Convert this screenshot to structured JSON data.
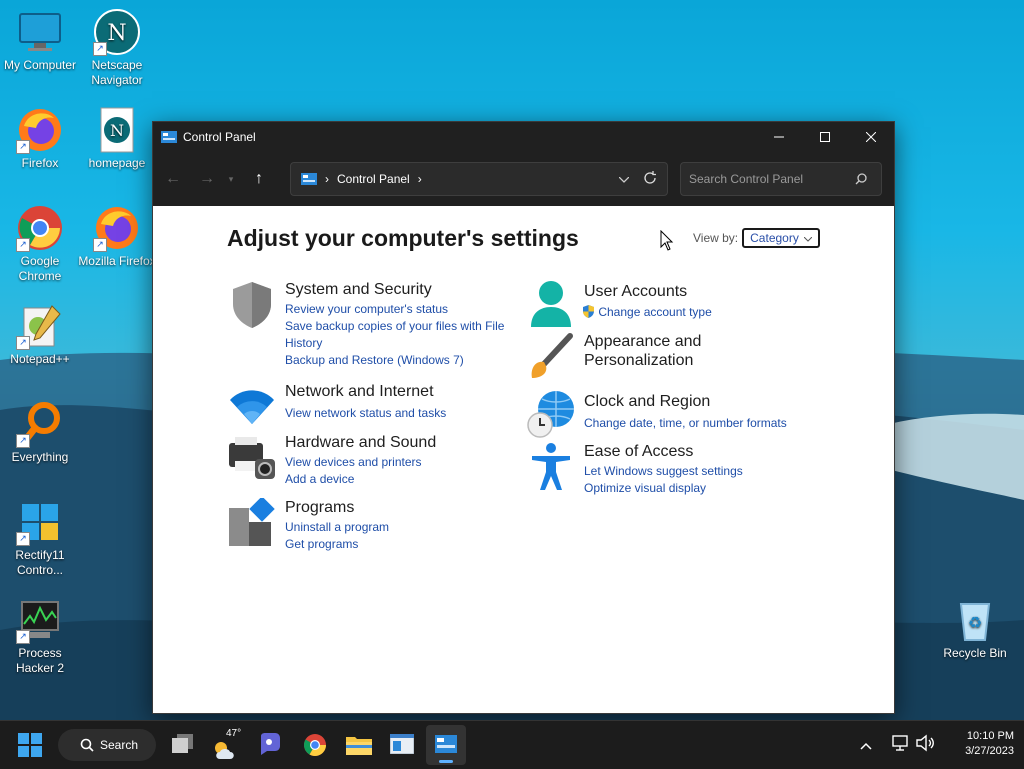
{
  "desktop": {
    "icons": [
      {
        "label": "My Computer"
      },
      {
        "label": "Netscape Navigator"
      },
      {
        "label": "Firefox"
      },
      {
        "label": "homepage"
      },
      {
        "label": "Google Chrome"
      },
      {
        "label": "Mozilla Firefox"
      },
      {
        "label": "Notepad++"
      },
      {
        "label": "Everything"
      },
      {
        "label": "Rectify11 Contro..."
      },
      {
        "label": "Process Hacker 2"
      },
      {
        "label": "Recycle Bin"
      }
    ]
  },
  "window": {
    "title": "Control Panel",
    "address": {
      "segment": "Control Panel",
      "sep": "›"
    },
    "search_placeholder": "Search Control Panel",
    "heading": "Adjust your computer's settings",
    "view_by_label": "View by:",
    "view_by_value": "Category",
    "categories": [
      {
        "title": "System and Security",
        "links": [
          "Review your computer's status",
          "Save backup copies of your files with File History",
          "Backup and Restore (Windows 7)"
        ]
      },
      {
        "title": "Network and Internet",
        "links": [
          "View network status and tasks"
        ]
      },
      {
        "title": "Hardware and Sound",
        "links": [
          "View devices and printers",
          "Add a device"
        ]
      },
      {
        "title": "Programs",
        "links": [
          "Uninstall a program",
          "Get programs"
        ]
      },
      {
        "title": "User Accounts",
        "links": [
          "Change account type"
        ]
      },
      {
        "title": "Appearance and Personalization",
        "links": []
      },
      {
        "title": "Clock and Region",
        "links": [
          "Change date, time, or number formats"
        ]
      },
      {
        "title": "Ease of Access",
        "links": [
          "Let Windows suggest settings",
          "Optimize visual display"
        ]
      }
    ]
  },
  "taskbar": {
    "search_label": "Search",
    "weather_temp": "47°",
    "time": "10:10 PM",
    "date": "3/27/2023"
  },
  "colors": {
    "accent": "#0078d4",
    "link": "#1f4ea8",
    "titlebar": "#202020"
  }
}
